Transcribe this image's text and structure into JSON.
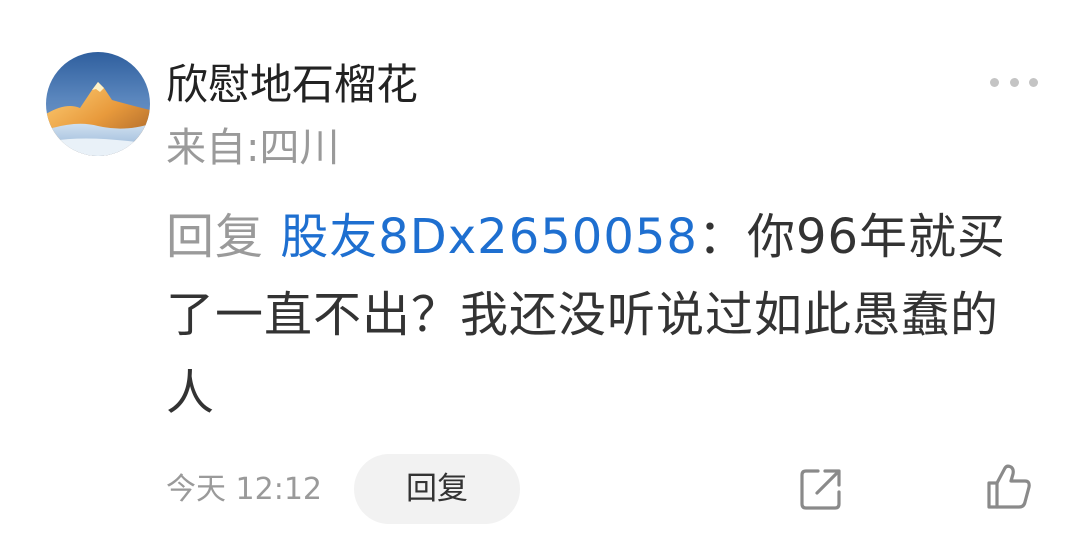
{
  "comment": {
    "author": {
      "name": "欣慰地石榴花",
      "location": "来自:四川",
      "avatar_icon": "mountain-sunset-avatar"
    },
    "more_icon": "more-dots-icon",
    "reply_prefix": "回复 ",
    "mention": "股友8Dx2650058",
    "separator": "：",
    "text": "你96年就买了一直不出？我还没听说过如此愚蠢的人",
    "timestamp": "今天 12:12",
    "reply_label": "回复",
    "share_icon": "share-icon",
    "like_icon": "thumbs-up-icon"
  },
  "colors": {
    "mention": "#1e6fd0",
    "secondary_text": "#9a9a9a",
    "primary_text": "#333333",
    "reply_button_bg": "#f2f2f2"
  }
}
